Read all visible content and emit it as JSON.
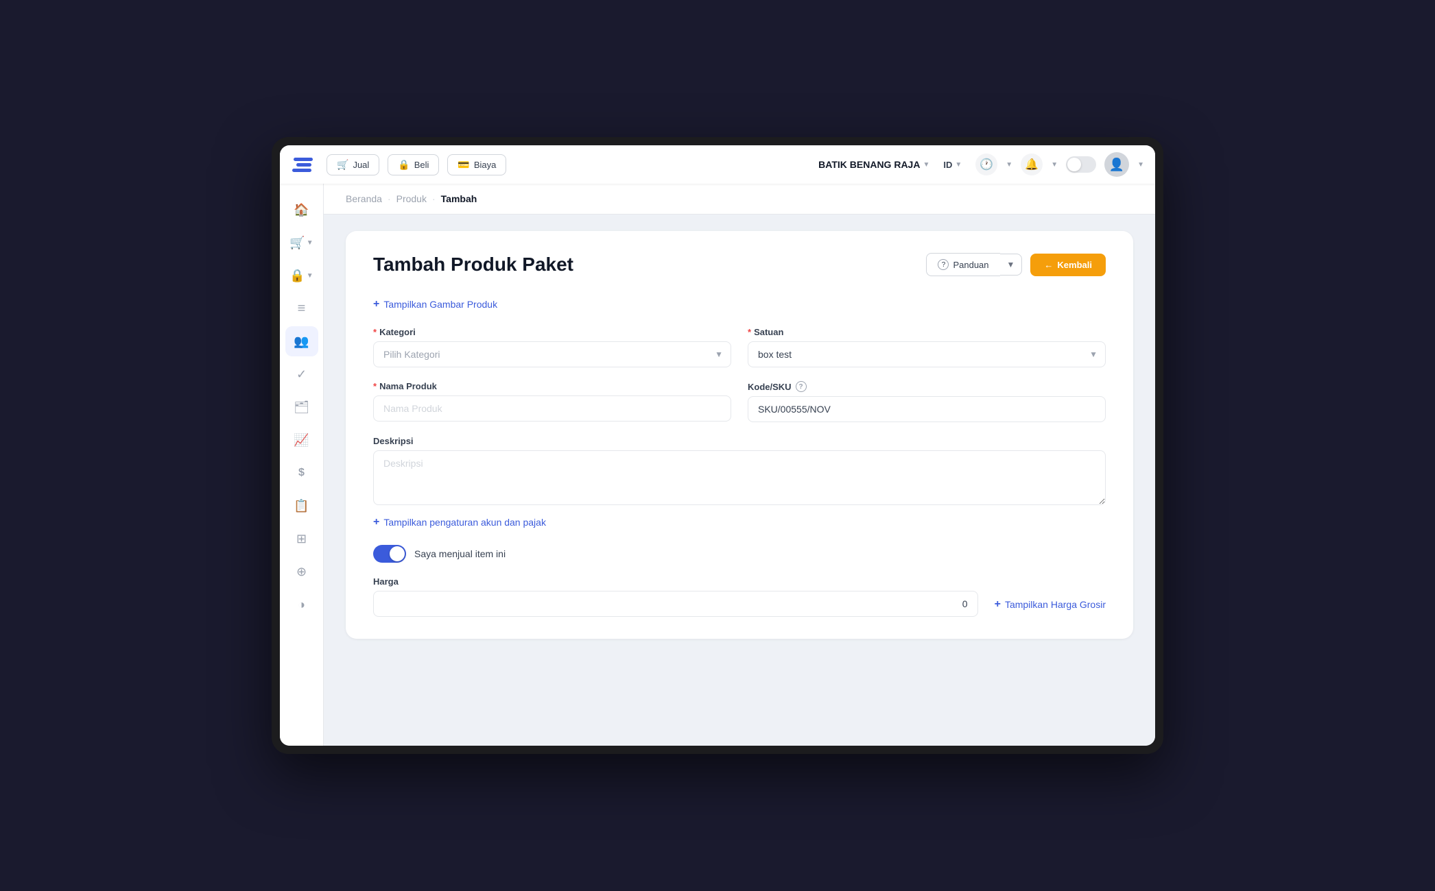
{
  "app": {
    "title": "Batik Benang Raja",
    "language": "ID"
  },
  "topnav": {
    "jual_label": "Jual",
    "beli_label": "Beli",
    "biaya_label": "Biaya",
    "brand_label": "BATIK BENANG RAJA",
    "lang_label": "ID"
  },
  "breadcrumb": {
    "beranda": "Beranda",
    "produk": "Produk",
    "tambah": "Tambah"
  },
  "form": {
    "title": "Tambah Produk Paket",
    "panduan_label": "Panduan",
    "kembali_label": "Kembali",
    "add_image_label": "Tampilkan Gambar Produk",
    "kategori_label": "Kategori",
    "kategori_placeholder": "Pilih Kategori",
    "satuan_label": "Satuan",
    "satuan_value": "box test",
    "nama_produk_label": "Nama Produk",
    "nama_produk_placeholder": "Nama Produk",
    "kode_sku_label": "Kode/SKU",
    "kode_sku_value": "SKU/00555/NOV",
    "deskripsi_label": "Deskripsi",
    "deskripsi_placeholder": "Deskripsi",
    "account_tax_label": "Tampilkan pengaturan akun dan pajak",
    "jual_toggle_label": "Saya menjual item ini",
    "harga_label": "Harga",
    "harga_value": "0",
    "harga_grosir_label": "Tampilkan Harga Grosir"
  },
  "sidebar": {
    "items": [
      {
        "icon": "🏠",
        "name": "home"
      },
      {
        "icon": "🛒",
        "name": "shop",
        "has_arrow": true
      },
      {
        "icon": "🔒",
        "name": "lock",
        "has_arrow": true
      },
      {
        "icon": "≡",
        "name": "menu"
      },
      {
        "icon": "👥",
        "name": "contacts",
        "active": true
      },
      {
        "icon": "✓",
        "name": "check"
      },
      {
        "icon": "🗂",
        "name": "archive"
      },
      {
        "icon": "📈",
        "name": "chart"
      },
      {
        "icon": "$",
        "name": "finance"
      },
      {
        "icon": "📋",
        "name": "report"
      },
      {
        "icon": "⊞",
        "name": "grid"
      },
      {
        "icon": "⊕",
        "name": "add"
      },
      {
        "icon": "◑",
        "name": "sync"
      }
    ]
  }
}
